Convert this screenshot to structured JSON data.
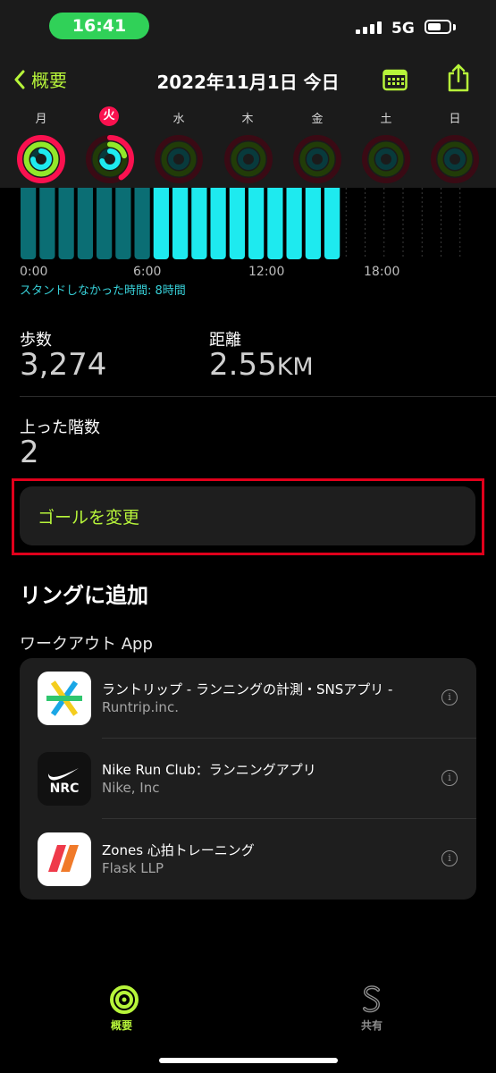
{
  "status_bar": {
    "time": "16:41",
    "network": "5G"
  },
  "header": {
    "back_label": "概要",
    "title": "2022年11月1日 今日"
  },
  "week": [
    {
      "day": "月",
      "active": false
    },
    {
      "day": "火",
      "active": true
    },
    {
      "day": "水",
      "active": false
    },
    {
      "day": "木",
      "active": false
    },
    {
      "day": "金",
      "active": false
    },
    {
      "day": "土",
      "active": false
    },
    {
      "day": "日",
      "active": false
    }
  ],
  "stand_chart": {
    "axis": [
      "0:00",
      "6:00",
      "12:00",
      "18:00"
    ],
    "note": "スタンドしなかった時間: 8時間",
    "hours": [
      0,
      0,
      0,
      0,
      0,
      0,
      0,
      1,
      1,
      1,
      1,
      1,
      1,
      1,
      1,
      1,
      1,
      null,
      null,
      null,
      null,
      null,
      null,
      null
    ]
  },
  "stats": {
    "steps_label": "歩数",
    "steps_value": "3,274",
    "distance_label": "距離",
    "distance_value": "2.55",
    "distance_unit": "KM",
    "floors_label": "上った階数",
    "floors_value": "2"
  },
  "change_goal_label": "ゴールを変更",
  "add_to_rings": {
    "title": "リングに追加",
    "subtitle": "ワークアウト App"
  },
  "apps": [
    {
      "name": "ラントリップ - ランニングの計測・SNSアプリ -",
      "developer": "Runtrip.inc."
    },
    {
      "name": "Nike Run Club：ランニングアプリ",
      "developer": "Nike, Inc",
      "icon_text": "NRC"
    },
    {
      "name": "Zones 心拍トレーニング",
      "developer": "Flask LLP"
    }
  ],
  "tabs": [
    {
      "label": "概要",
      "active": true
    },
    {
      "label": "共有",
      "active": false
    }
  ],
  "colors": {
    "accent": "#b7f53a",
    "move": "#fa114f",
    "exercise": "#92e82a",
    "stand": "#1eeaef",
    "highlight": "#e0001b"
  }
}
